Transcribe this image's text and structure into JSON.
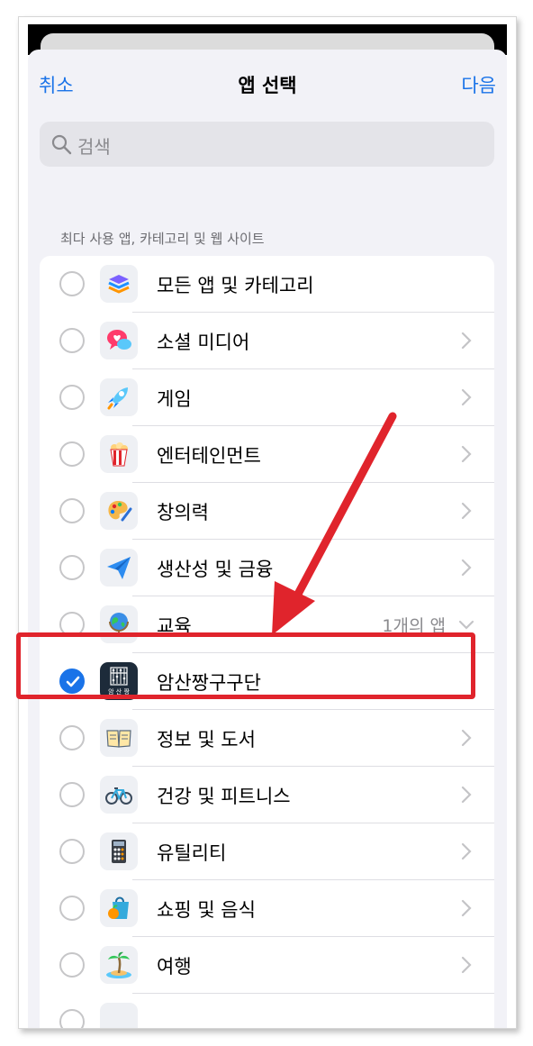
{
  "nav": {
    "cancel": "취소",
    "title": "앱 선택",
    "next": "다음"
  },
  "search": {
    "placeholder": "검색"
  },
  "section_header": "최다 사용 앱, 카테고리 및 웹 사이트",
  "rows": [
    {
      "label": "모든 앱 및 카테고리",
      "icon": "stack-icon",
      "checked": false,
      "chevron": false
    },
    {
      "label": "소셜 미디어",
      "icon": "chat-heart-icon",
      "checked": false,
      "chevron": true
    },
    {
      "label": "게임",
      "icon": "rocket-icon",
      "checked": false,
      "chevron": true
    },
    {
      "label": "엔터테인먼트",
      "icon": "popcorn-icon",
      "checked": false,
      "chevron": true
    },
    {
      "label": "창의력",
      "icon": "palette-icon",
      "checked": false,
      "chevron": true
    },
    {
      "label": "생산성 및 금융",
      "icon": "paper-plane-icon",
      "checked": false,
      "chevron": true
    },
    {
      "label": "교육",
      "icon": "globe-icon",
      "checked": false,
      "detail": "1개의 앱",
      "expanded": true
    },
    {
      "label": "암산짱구구단",
      "icon": "abacus-app-icon",
      "checked": true,
      "chevron": false,
      "app_icon_text": "암 산 짱"
    },
    {
      "label": "정보 및 도서",
      "icon": "book-icon",
      "checked": false,
      "chevron": true
    },
    {
      "label": "건강 및 피트니스",
      "icon": "bicycle-icon",
      "checked": false,
      "chevron": true
    },
    {
      "label": "유틸리티",
      "icon": "calculator-icon",
      "checked": false,
      "chevron": true
    },
    {
      "label": "쇼핑 및 음식",
      "icon": "shopping-bag-icon",
      "checked": false,
      "chevron": true
    },
    {
      "label": "여행",
      "icon": "palm-tree-icon",
      "checked": false,
      "chevron": true
    }
  ],
  "colors": {
    "accent": "#1a73e8",
    "highlight": "#e0242c",
    "arrow": "#e0242c"
  }
}
